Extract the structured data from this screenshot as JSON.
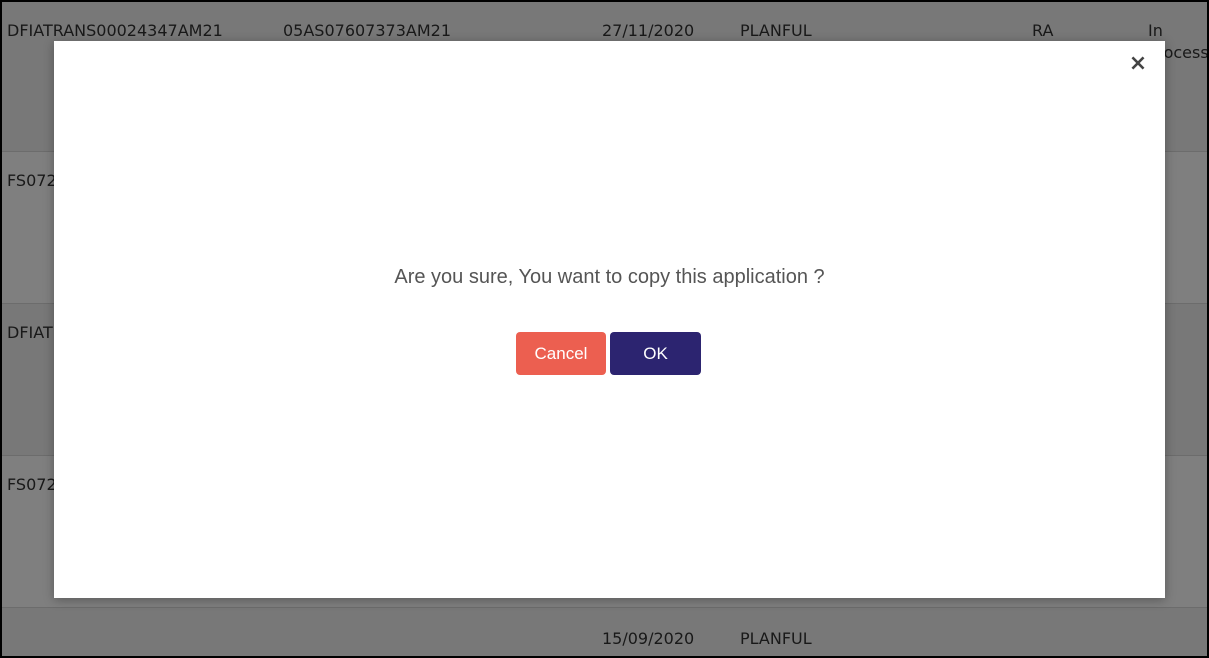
{
  "table": {
    "rows": [
      {
        "id": "DFIATRANS00024347AM21",
        "ref": "05AS07607373AM21",
        "date": "27/11/2020",
        "client": "PLANFUL",
        "code": "RA",
        "status": "In Process"
      },
      {
        "id": "FS072",
        "ref": "",
        "date": "",
        "client": "",
        "code": "",
        "status": ""
      },
      {
        "id": "DFIAT",
        "ref": "",
        "date": "",
        "client": "",
        "code": "",
        "status": ""
      },
      {
        "id": "FS072",
        "ref": "",
        "date": "",
        "client": "",
        "code": "",
        "status": ""
      },
      {
        "id": "",
        "ref": "",
        "date": "15/09/2020",
        "client": "PLANFUL",
        "code": "",
        "status": ""
      }
    ]
  },
  "modal": {
    "close_glyph": "×",
    "message": "Are you sure, You want to copy this application ?",
    "cancel_label": "Cancel",
    "ok_label": "OK"
  },
  "colors": {
    "cancel_button": "#ec5f50",
    "ok_button": "#2c2470",
    "overlay": "rgba(0,0,0,0.5)"
  }
}
